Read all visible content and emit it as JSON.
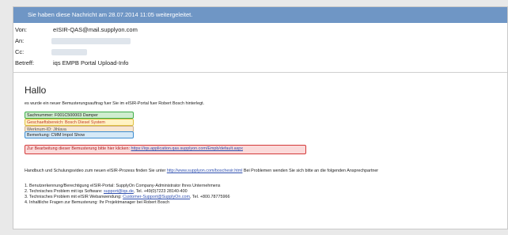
{
  "forward_notice": "Sie haben diese Nachricht am 28.07.2014 11:05 weitergeleitet.",
  "header": {
    "from_label": "Von:",
    "from_value": "eISIR-QAS@mail.supplyon.com",
    "to_label": "An:",
    "cc_label": "Cc:",
    "subject_label": "Betreff:",
    "subject_value": "iqs EMPB Portal Upload-Info"
  },
  "body": {
    "greeting": "Hallo",
    "intro": "es wurde ein neuer Bemusterungsauftrag fuer Sie im eISIR-Portal fuer Robert Bosch hinterlegt.",
    "sachnummer": "Sachnummer: F001C500003 Damper",
    "geschaeftsbereich": "Geschaeftsbereich: Bosch Diesel System",
    "werk": "Werknum-ID: Jihlava",
    "bemerkung": "Bemerkung: CMM Impol Show",
    "link_text": "Zur Bearbeitung dieser Bemusterung bitte hier klicken:",
    "link_url": "https://iqs.application.qas.supplyon.com/Empb/default.aspx",
    "handbuch_text": "Handbuch und Schulungsvideo zum neuen eISIR-Prozess finden Sie unter",
    "handbuch_link": "http://www.supplyon.com/boschesir.html",
    "handbuch_rest": "Bei Problemen wenden Sie sich bitte an die folgenden Ansprechpartner",
    "list": [
      {
        "text": "1. Benutzerkennung/Berechtigung eISIR-Portal: SupplyOn Company-Administrator Ihres Unternehmens",
        "link": "",
        "after": ""
      },
      {
        "text": "2. Technisches Problem mit iqs Software:",
        "link": "support@iqs.de",
        "after": ", Tel. +49(0)7223 28140-400"
      },
      {
        "text": "3. Technisches Problem mit eISIR Webanwendung:",
        "link": "Customer-Support@SupplyOn.com",
        "after": ", Tel. +800.78775966"
      },
      {
        "text": "4. Inhaltliche Fragen zur Bemusterung: Ihr Projektmanager bei Robert Bosch",
        "link": "",
        "after": ""
      }
    ]
  },
  "colors": {
    "forward_bar": "#6f96c5",
    "green_box": "#3fae4a",
    "yellow_box": "#e0c040",
    "blue_box": "#3d8cd0",
    "red_box": "#d43a3a"
  }
}
